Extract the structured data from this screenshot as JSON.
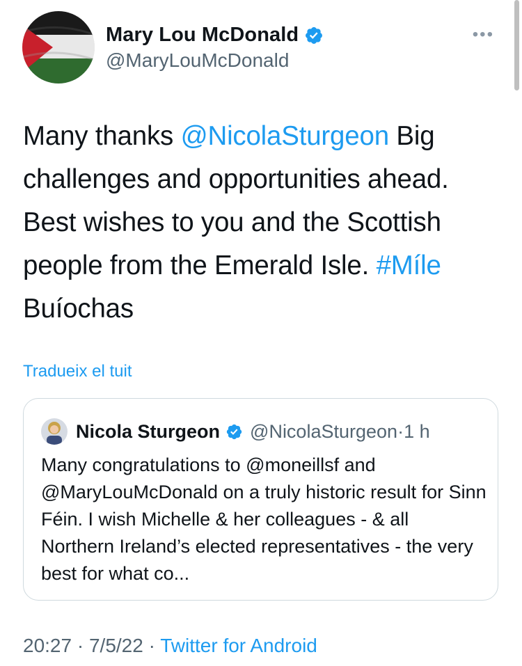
{
  "author": {
    "display_name": "Mary Lou McDonald",
    "handle": "@MaryLouMcDonald",
    "verified_icon": "verified-badge-icon",
    "avatar_icon": "palestinian-flag-avatar"
  },
  "more_label": "•••",
  "tweet": {
    "part1": "Many thanks ",
    "mention": "@NicolaSturgeon",
    "part2": " Big challenges and opportunities ahead. Best wishes to you and the Scottish people from the Emerald Isle. ",
    "hashtag": "#Míle",
    "part3": " Buíochas"
  },
  "translate_label": "Tradueix el tuit",
  "quoted": {
    "display_name": "Nicola Sturgeon",
    "handle": "@NicolaSturgeon",
    "separator": " · ",
    "time": "1 h",
    "text": "Many congratulations to @moneillsf and @MaryLouMcDonald on a truly historic result for Sinn Féin. I wish Michelle & her colleagues - & all Northern Ireland’s elected representatives - the very best for what co..."
  },
  "footer": {
    "time": "20:27",
    "sep1": " · ",
    "date": "7/5/22",
    "sep2": " · ",
    "source": "Twitter for Android"
  },
  "colors": {
    "link": "#1d9bf0",
    "text": "#0f1419",
    "secondary": "#536471",
    "border": "#cfd9de"
  }
}
